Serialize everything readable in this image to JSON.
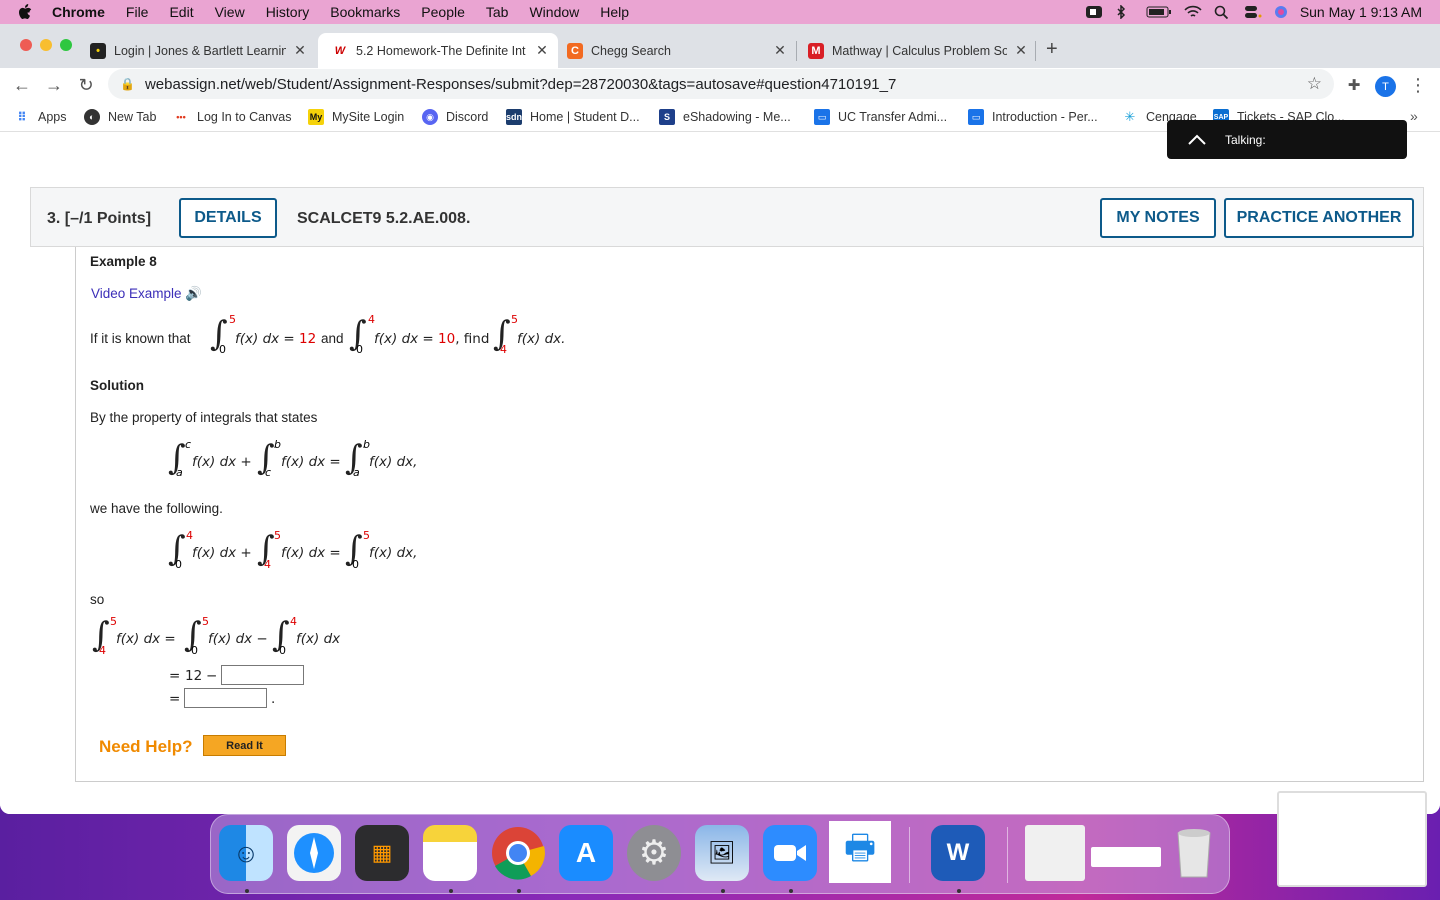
{
  "menubar": {
    "app": "Chrome",
    "items": [
      "File",
      "Edit",
      "View",
      "History",
      "Bookmarks",
      "People",
      "Tab",
      "Window",
      "Help"
    ],
    "clock": "Sun May 1  9:13 AM"
  },
  "tabs": [
    {
      "title": "Login | Jones & Bartlett Learnin",
      "icon": "jones-bartlett-favicon",
      "active": false
    },
    {
      "title": "5.2 Homework-The Definite Int",
      "icon": "webassign-favicon",
      "active": true
    },
    {
      "title": "Chegg Search",
      "icon": "chegg-favicon",
      "active": false
    },
    {
      "title": "Mathway | Calculus Problem So",
      "icon": "mathway-favicon",
      "active": false
    }
  ],
  "toolbar": {
    "url": "webassign.net/web/Student/Assignment-Responses/submit?dep=28720030&tags=autosave#question4710191_7",
    "profile_initial": "T"
  },
  "bookmarks": [
    "Apps",
    "New Tab",
    "Log In to Canvas",
    "MySite Login",
    "Discord",
    "Home | Student D...",
    "eShadowing - Me...",
    "UC Transfer Admi...",
    "Introduction - Per...",
    "Cengage",
    "Tickets - SAP Clo..."
  ],
  "talking": {
    "label": "Talking:"
  },
  "question": {
    "number": "3.",
    "points": "[–/1 Points]",
    "details_button": "DETAILS",
    "code": "SCALCET9 5.2.AE.008.",
    "my_notes_button": "MY NOTES",
    "practice_button": "PRACTICE ANOTHER"
  },
  "example": {
    "title": "Example 8",
    "video": "Video Example",
    "prompt_pre": "If it is known that",
    "given1": {
      "lower": "0",
      "upper": "5",
      "expr": "f(x) dx =",
      "value": "12"
    },
    "and": "and",
    "given2": {
      "lower": "0",
      "upper": "4",
      "expr": "f(x) dx =",
      "value": "10",
      "suffix": ", find"
    },
    "find": {
      "lower": "4",
      "upper": "5",
      "expr": "f(x) dx."
    },
    "solution_title": "Solution",
    "property_text": "By the property of integrals that states",
    "property": {
      "i1": {
        "lower": "a",
        "upper": "c"
      },
      "i2": {
        "lower": "c",
        "upper": "b"
      },
      "i3": {
        "lower": "a",
        "upper": "b"
      },
      "t1": "f(x) dx +",
      "t2": "f(x) dx =",
      "t3": "f(x) dx,"
    },
    "follow_text": "we have the following.",
    "applied": {
      "i1": {
        "lower": "0",
        "upper": "4"
      },
      "i2": {
        "lower": "4",
        "upper": "5"
      },
      "i3": {
        "lower": "0",
        "upper": "5"
      },
      "t1": "f(x) dx +",
      "t2": "f(x) dx =",
      "t3": "f(x) dx,"
    },
    "so_text": "so",
    "final": {
      "i1": {
        "lower": "4",
        "upper": "5"
      },
      "i2": {
        "lower": "0",
        "upper": "5"
      },
      "i3": {
        "lower": "0",
        "upper": "4"
      },
      "t1": "f(x) dx  =",
      "t2": "f(x) dx −",
      "t3": "f(x) dx"
    },
    "line2": {
      "eq": "=",
      "value": "12",
      "minus": "−",
      "answer": ""
    },
    "line3": {
      "eq": "=",
      "answer": "",
      "period": "."
    },
    "need_help": "Need Help?",
    "read_it": "Read It"
  },
  "colors": {
    "accent": "#0d5a8a",
    "given_value": "#dd0000",
    "need_help": "#f08a00"
  }
}
